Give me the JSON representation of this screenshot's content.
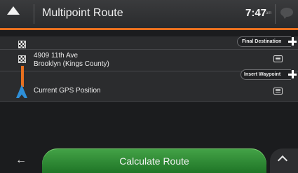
{
  "header": {
    "title": "Multipoint Route",
    "time": "7:47",
    "ampm": "am"
  },
  "route": {
    "final_destination_label": "Final Destination",
    "insert_waypoint_label": "Insert Waypoint",
    "destination": {
      "line1": "4909 11th Ave",
      "line2": "Brooklyn (Kings County)"
    },
    "start": {
      "label": "Current GPS Position"
    }
  },
  "footer": {
    "calculate_label": "Calculate Route"
  },
  "icons": {
    "back": "back-arrow-icon",
    "up": "up-triangle-icon",
    "chat": "chat-bubble-icon",
    "flag": "checkered-flag-icon",
    "gps": "gps-arrow-icon",
    "add": "plus-icon",
    "menu": "menu-icon",
    "more": "chevron-up-icon"
  },
  "colors": {
    "accent": "#e8701f",
    "calculate": "#2d8f34",
    "gps": "#2e8fd8"
  }
}
